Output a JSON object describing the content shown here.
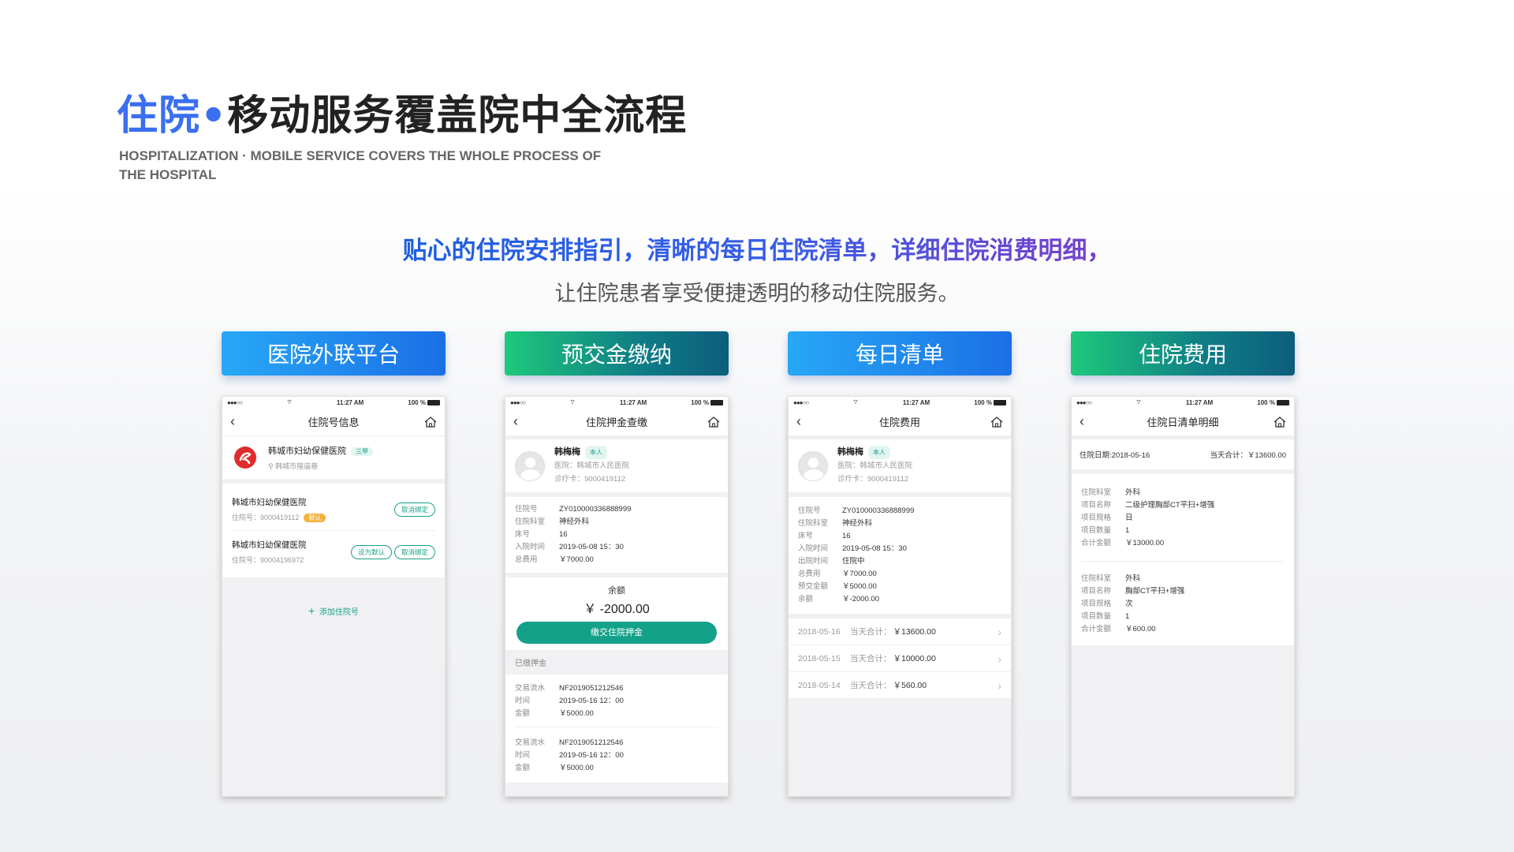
{
  "header": {
    "title_highlight": "住院",
    "title_dot": "•",
    "title_rest": "移动服务覆盖院中全流程",
    "subtitle_en": "HOSPITALIZATION · MOBILE SERVICE COVERS THE WHOLE PROCESS OF THE HOSPITAL"
  },
  "slogan": {
    "line1": "贴心的住院安排指引，清晰的每日住院清单，详细住院消费明细，",
    "line2": "让住院患者享受便捷透明的移动住院服务。"
  },
  "status_bar": {
    "signal": "●●●○○",
    "wifi": "wifi-icon",
    "time": "11:27 AM",
    "battery": "100 %"
  },
  "colors": {
    "blue_start": "#27a8f6",
    "blue_end": "#1b6fe6",
    "green_start": "#1ec97c",
    "green_end": "#0d5e7c",
    "teal": "#14a18a"
  },
  "panels": [
    {
      "button": "医院外联平台",
      "nav_title": "住院号信息",
      "hospital_name": "韩城市妇幼保健医院",
      "hospital_level": "三甲",
      "hospital_addr": "韩城市隍庙巷",
      "bindings": [
        {
          "name": "韩城市妇幼保健医院",
          "no_label": "住院号：",
          "no": "9000419112",
          "default_tag": "默认",
          "actions": [
            "取消绑定"
          ]
        },
        {
          "name": "韩城市妇幼保健医院",
          "no_label": "住院号：",
          "no": "90004196972",
          "actions": [
            "设为默认",
            "取消绑定"
          ]
        }
      ],
      "add_label": "添加住院号"
    },
    {
      "button": "预交金缴纳",
      "nav_title": "住院押金查缴",
      "patient": {
        "name": "韩梅梅",
        "tag": "本人",
        "hospital": "医院：韩城市人民医院",
        "card": "诊疗卡：9000419112"
      },
      "info": [
        {
          "k": "住院号",
          "v": "ZY010000336888999"
        },
        {
          "k": "住院科室",
          "v": "神经外科"
        },
        {
          "k": "床号",
          "v": "16"
        },
        {
          "k": "入院时间",
          "v": "2019-05-08 15：30"
        },
        {
          "k": "总费用",
          "v": "￥7000.00"
        }
      ],
      "balance_label": "余额",
      "balance": "￥ -2000.00",
      "pay_button": "缴交住院押金",
      "paid_section": "已缴押金",
      "records": [
        [
          {
            "k": "交易流水",
            "v": "NF2019051212546"
          },
          {
            "k": "时间",
            "v": "2019-05-16 12：00"
          },
          {
            "k": "金额",
            "v": "￥5000.00"
          }
        ],
        [
          {
            "k": "交易流水",
            "v": "NF2019051212546"
          },
          {
            "k": "时间",
            "v": "2019-05-16 12：00"
          },
          {
            "k": "金额",
            "v": "￥5000.00"
          }
        ]
      ]
    },
    {
      "button": "每日清单",
      "nav_title": "住院费用",
      "patient": {
        "name": "韩梅梅",
        "tag": "本人",
        "hospital": "医院：韩城市人民医院",
        "card": "诊疗卡：9000419112"
      },
      "info": [
        {
          "k": "住院号",
          "v": "ZY010000336888999"
        },
        {
          "k": "住院科室",
          "v": "神经外科"
        },
        {
          "k": "床号",
          "v": "16"
        },
        {
          "k": "入院时间",
          "v": "2019-05-08 15：30"
        },
        {
          "k": "出院时间",
          "v": "住院中"
        },
        {
          "k": "总费用",
          "v": "￥7000.00"
        },
        {
          "k": "预交金额",
          "v": "￥5000.00"
        },
        {
          "k": "余额",
          "v": "￥-2000.00"
        }
      ],
      "daily": [
        {
          "date": "2018-05-16",
          "label": "当天合计：",
          "amount": "￥13600.00"
        },
        {
          "date": "2018-05-15",
          "label": "当天合计：",
          "amount": "￥10000.00"
        },
        {
          "date": "2018-05-14",
          "label": "当天合计：",
          "amount": "￥560.00"
        }
      ]
    },
    {
      "button": "住院费用",
      "nav_title": "住院日清单明细",
      "date_line": "住院日期:2018-05-16",
      "total_line": "当天合计：￥13600.00",
      "items": [
        [
          {
            "k": "住院科室",
            "v": "外科"
          },
          {
            "k": "项目名称",
            "v": "二级护理胸部CT平扫+增强"
          },
          {
            "k": "项目规格",
            "v": "日"
          },
          {
            "k": "项目数量",
            "v": "1"
          },
          {
            "k": "合计金额",
            "v": "￥13000.00"
          }
        ],
        [
          {
            "k": "住院科室",
            "v": "外科"
          },
          {
            "k": "项目名称",
            "v": "胸部CT平扫+增强"
          },
          {
            "k": "项目规格",
            "v": "次"
          },
          {
            "k": "项目数量",
            "v": "1"
          },
          {
            "k": "合计金额",
            "v": "￥600.00"
          }
        ]
      ]
    }
  ]
}
